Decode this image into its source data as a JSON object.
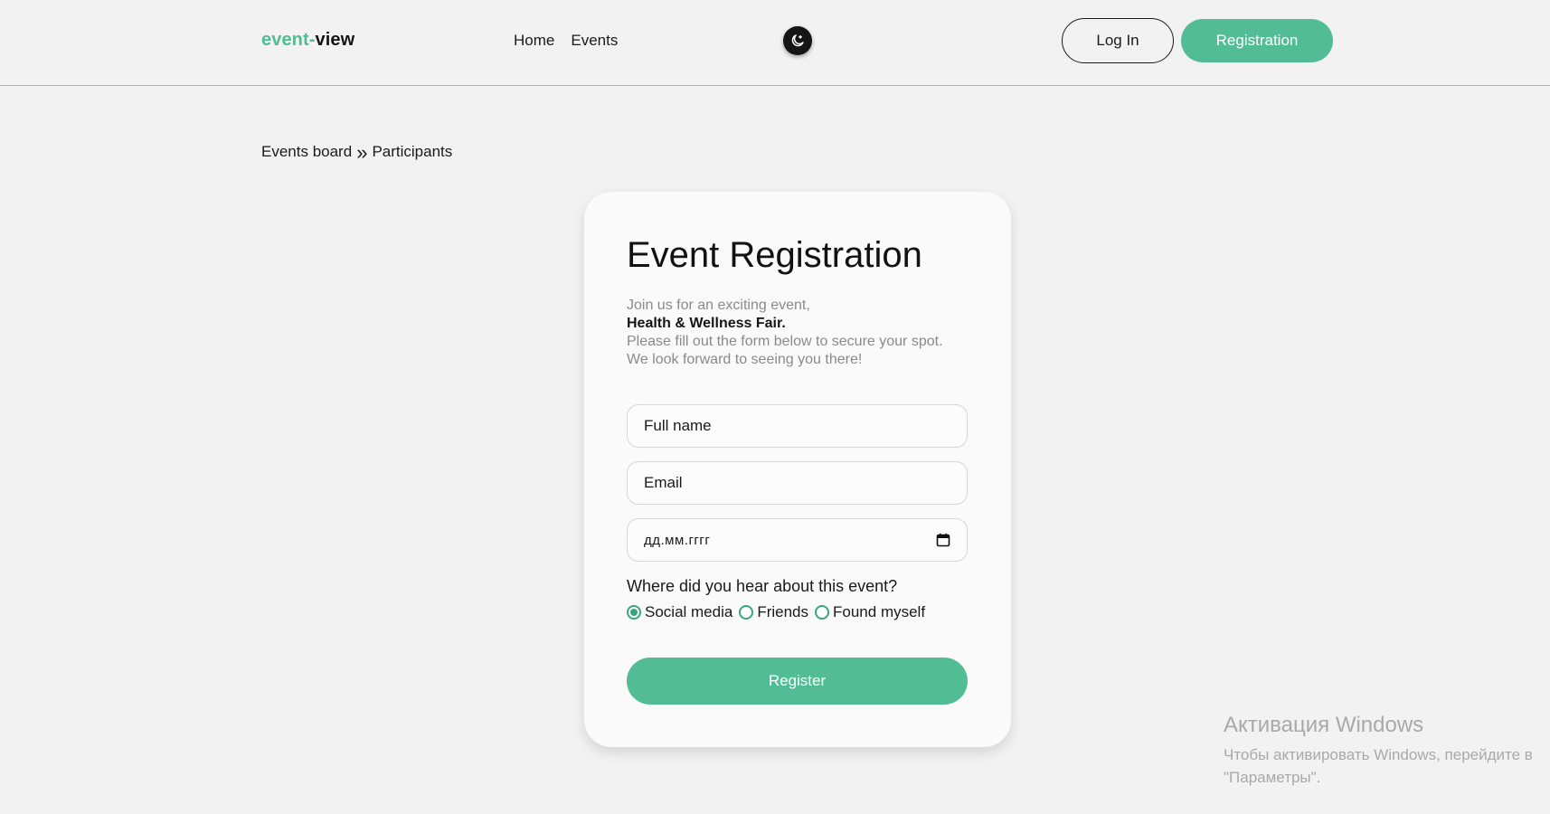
{
  "header": {
    "logo_accent": "event-",
    "logo_rest": "view",
    "nav": [
      "Home",
      "Events"
    ],
    "theme_icon": "moon-stars-icon",
    "login_label": "Log In",
    "register_label": "Registration"
  },
  "breadcrumb": {
    "items": [
      "Events board",
      "Participants"
    ],
    "separator": "»"
  },
  "form": {
    "title": "Event Registration",
    "intro_line1": "Join us for an exciting event,",
    "event_name": "Health & Wellness Fair.",
    "intro_line2": "Please fill out the form below to secure your spot.",
    "intro_line3": "We look forward to seeing you there!",
    "fullname_placeholder": "Full name",
    "email_placeholder": "Email",
    "date_placeholder": "дд.мм.гггг",
    "question": "Where did you hear about this event?",
    "options": [
      "Social media",
      "Friends",
      "Found myself"
    ],
    "selected_option": "Social media",
    "submit_label": "Register"
  },
  "watermark": {
    "title": "Активация Windows",
    "line1": "Чтобы активировать Windows, перейдите в",
    "line2": "\"Параметры\"."
  },
  "colors": {
    "accent": "#52bd94",
    "radio": "#3aa57d",
    "background": "#f2f2f2",
    "card": "#fafafa"
  }
}
